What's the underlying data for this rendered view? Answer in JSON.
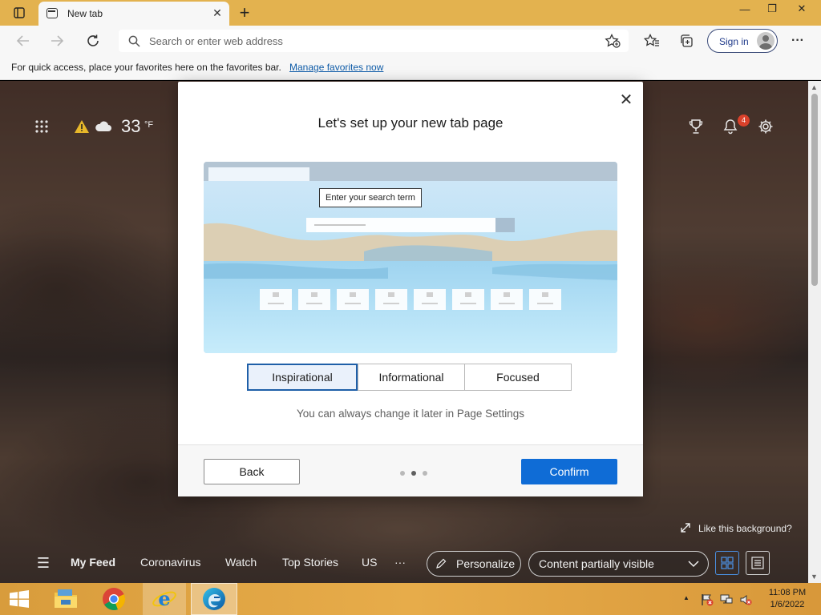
{
  "browser": {
    "tab": {
      "title": "New tab",
      "close_glyph": "✕",
      "favicon": "new-tab-page-icon"
    },
    "new_tab_glyph": "+",
    "window_controls": {
      "minimize": "—",
      "restore": "❐",
      "close": "✕"
    },
    "address_bar": {
      "placeholder": "Search or enter web address",
      "value": ""
    },
    "signin_label": "Sign in",
    "more_glyph": "···",
    "favorites_bar": {
      "message": "For quick access, place your favorites here on the favorites bar.",
      "link": "Manage favorites now"
    }
  },
  "ntp": {
    "apps_glyph": "⋮⋮⋮",
    "weather": {
      "temperature": "33",
      "unit": "°F",
      "icons": [
        "warning-icon",
        "cloud-icon"
      ]
    },
    "notifications_count": "4",
    "like_background": "Like this background?",
    "feed": {
      "menu_glyph": "☰",
      "items": [
        "My Feed",
        "Coronavirus",
        "Watch",
        "Top Stories",
        "US"
      ],
      "more": "···",
      "personalize": "Personalize",
      "visibility_select": "Content partially visible"
    }
  },
  "modal": {
    "title": "Let's set up your new tab page",
    "close_glyph": "✕",
    "preview_tooltip": "Enter your search term",
    "options": [
      "Inspirational",
      "Informational",
      "Focused"
    ],
    "selected_option": "Inspirational",
    "hint": "You can always change it later in Page Settings",
    "back_label": "Back",
    "confirm_label": "Confirm",
    "step": {
      "current": 2,
      "total": 3
    }
  },
  "taskbar": {
    "apps": [
      "start-button",
      "file-explorer-icon",
      "chrome-icon",
      "internet-explorer-icon",
      "edge-icon"
    ],
    "active_app": "edge-icon",
    "clock": {
      "time": "11:08 PM",
      "date": "1/6/2022"
    }
  },
  "colors": {
    "title_bar": "#e3b24f",
    "accent_blue": "#0f6cd6",
    "selected_outline": "#1f5fa8",
    "notification_badge": "#d9412b",
    "taskbar": "#e7ac4a"
  }
}
